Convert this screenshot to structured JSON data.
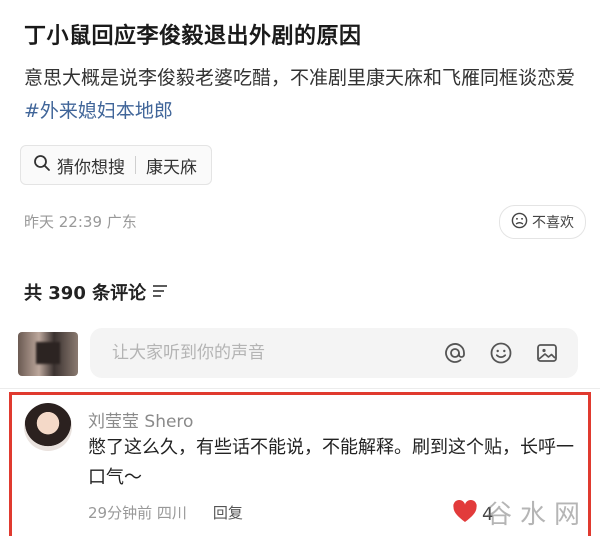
{
  "post": {
    "title": "丁小鼠回应李俊毅退出外剧的原因",
    "body_text": "意思大概是说李俊毅老婆吃醋，不准剧里康天庥和飞雁同框谈恋爱",
    "hashtag": "#外来媳妇本地郎"
  },
  "search_chip": {
    "label": "猜你想搜",
    "query": "康天庥",
    "icon": "search-icon"
  },
  "meta": {
    "time": "昨天 22:39",
    "location": "广东",
    "dislike_label": "不喜欢"
  },
  "comments": {
    "header": "共 390 条评论",
    "input_placeholder": "让大家听到你的声音",
    "input_icons": [
      "at-icon",
      "emoji-icon",
      "image-icon"
    ],
    "items": [
      {
        "user": "刘莹莹 Shero",
        "text": "憋了这么久，有些话不能说，不能解释。刷到这个贴，长呼一口气～",
        "time": "29分钟前",
        "location": "四川",
        "reply_label": "回复",
        "likes": "4"
      }
    ]
  },
  "watermark": "谷水网",
  "colors": {
    "hashtag": "#406599",
    "highlight_border": "#e03a2f",
    "like_heart": "#e23b3b"
  }
}
